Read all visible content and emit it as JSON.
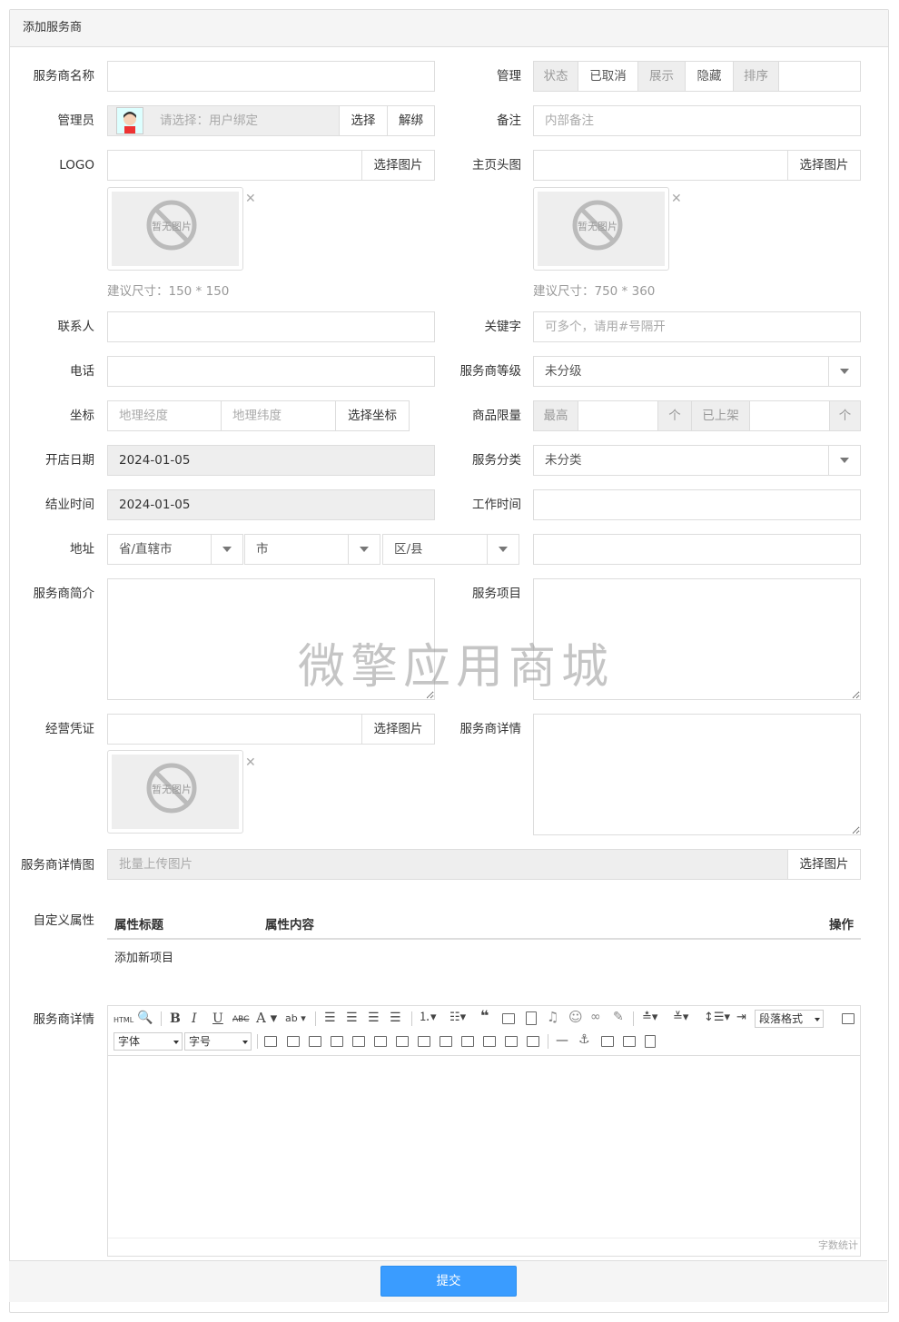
{
  "panel": {
    "title": "添加服务商"
  },
  "fields": {
    "name_label": "服务商名称",
    "manage_label": "管理",
    "manage_options": [
      "状态",
      "已取消",
      "展示",
      "隐藏",
      "排序"
    ],
    "admin_label": "管理员",
    "admin_placeholder": "请选择：用户绑定",
    "admin_select": "选择",
    "admin_unbind": "解绑",
    "remark_label": "备注",
    "remark_placeholder": "内部备注",
    "logo_label": "LOGO",
    "logo_button": "选择图片",
    "logo_hint": "建议尺寸：150 * 150",
    "banner_label": "主页头图",
    "banner_button": "选择图片",
    "banner_hint": "建议尺寸：750 * 360",
    "no_image": "暂无图片",
    "contact_label": "联系人",
    "keyword_label": "关键字",
    "keyword_placeholder": "可多个，请用#号隔开",
    "phone_label": "电话",
    "level_label": "服务商等级",
    "level_value": "未分级",
    "coord_label": "坐标",
    "lng_placeholder": "地理经度",
    "lat_placeholder": "地理纬度",
    "coord_button": "选择坐标",
    "limit_label": "商品限量",
    "limit_max": "最高",
    "limit_unit1": "个",
    "limit_listed": "已上架",
    "limit_unit2": "个",
    "open_date_label": "开店日期",
    "open_date_value": "2024-01-05",
    "category_label": "服务分类",
    "category_value": "未分类",
    "close_time_label": "结业时间",
    "close_time_value": "2024-01-05",
    "work_time_label": "工作时间",
    "address_label": "地址",
    "province": "省/直辖市",
    "city": "市",
    "district": "区/县",
    "intro_label": "服务商简介",
    "service_label": "服务项目",
    "license_label": "经营凭证",
    "license_button": "选择图片",
    "detail_label": "服务商详情",
    "detail_images_label": "服务商详情图",
    "detail_images_placeholder": "批量上传图片",
    "detail_images_button": "选择图片",
    "custom_label": "自定义属性",
    "custom_col_title": "属性标题",
    "custom_col_content": "属性内容",
    "custom_col_action": "操作",
    "custom_add": "添加新项目",
    "editor_label": "服务商详情"
  },
  "editor": {
    "html_btn": "HTML",
    "paragraph": "段落格式",
    "font": "字体",
    "size": "字号",
    "word_count": "字数统计"
  },
  "footer": {
    "submit": "提交"
  },
  "watermark": "微擎应用商城"
}
